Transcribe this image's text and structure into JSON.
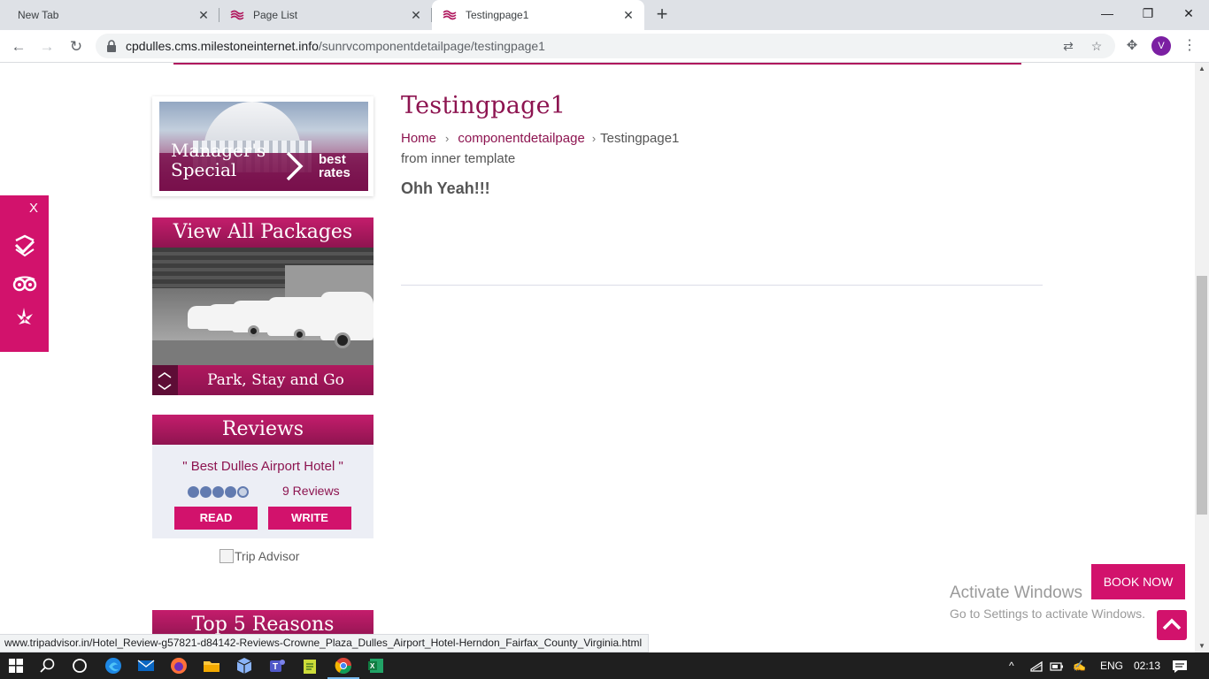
{
  "browser": {
    "tabs": [
      {
        "title": "New Tab"
      },
      {
        "title": "Page List"
      },
      {
        "title": "Testingpage1"
      }
    ],
    "url": {
      "host": "cpdulles.cms.milestoneinternet.info",
      "path": "/sunrvcomponentdetailpage/testingpage1"
    },
    "profile_initial": "V",
    "status_link": "www.tripadvisor.in/Hotel_Review-g57821-d84142-Reviews-Crowne_Plaza_Dulles_Airport_Hotel-Herndon_Fairfax_County_Virginia.html"
  },
  "sidebar": {
    "special": {
      "title_line1": "Manager's",
      "title_line2": "Special",
      "best_line1": "best",
      "best_line2": "rates"
    },
    "packages": {
      "header": "View All Packages",
      "caption": "Park, Stay and Go"
    },
    "reviews": {
      "header": "Reviews",
      "quote": "\" Best Dulles Airport Hotel \"",
      "rating": 4,
      "rating_max": 5,
      "count_label": "9 Reviews",
      "read_label": "READ",
      "write_label": "WRITE",
      "tripadvisor_alt": "Trip Advisor"
    },
    "top5": {
      "header": "Top 5 Reasons"
    }
  },
  "main": {
    "title": "Testingpage1",
    "breadcrumb": {
      "home": "Home",
      "parent": "componentdetailpage",
      "current": "Testingpage1"
    },
    "note": "from inner template",
    "heading": "Ohh Yeah!!!"
  },
  "social_bar": {
    "close_label": "X",
    "icons": [
      "foursquare-icon",
      "tripadvisor-icon",
      "yelp-icon"
    ]
  },
  "cta": {
    "book_now": "BOOK NOW"
  },
  "watermark": {
    "line1": "Activate Windows",
    "line2": "Go to Settings to activate Windows."
  },
  "taskbar": {
    "language": "ENG",
    "time": "02:13"
  },
  "colors": {
    "brand": "#d2126c",
    "brand_dark": "#8d1450",
    "rating": "#627bb0"
  }
}
